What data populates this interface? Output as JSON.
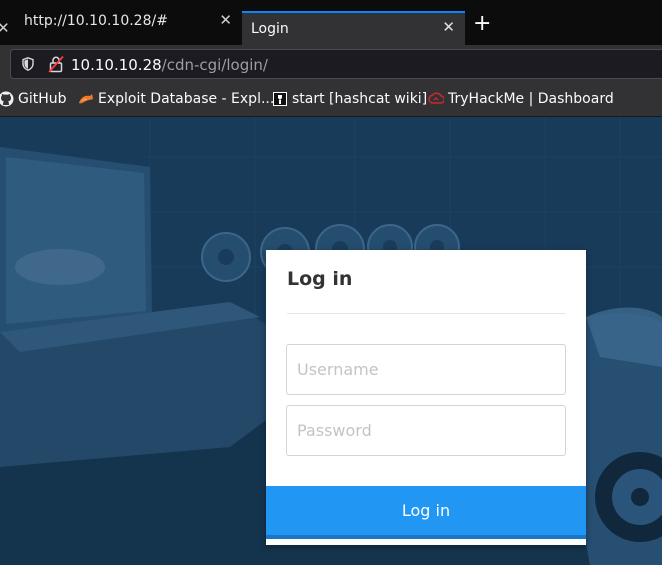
{
  "tabs": [
    {
      "title": "http://10.10.10.28/#",
      "active": false
    },
    {
      "title": "Login",
      "active": true
    }
  ],
  "urlbar": {
    "host": "10.10.10.28",
    "path": "/cdn-cgi/login/"
  },
  "bookmarks": [
    {
      "label": "GitHub",
      "icon": "github-icon"
    },
    {
      "label": "Exploit Database - Expl...",
      "icon": "exploit-db-icon"
    },
    {
      "label": "start [hashcat wiki]",
      "icon": "hashcat-icon"
    },
    {
      "label": "TryHackMe | Dashboard",
      "icon": "tryhackme-icon"
    }
  ],
  "login": {
    "title": "Log in",
    "username_placeholder": "Username",
    "password_placeholder": "Password",
    "button_label": "Log in"
  },
  "colors": {
    "accent": "#0a84ff",
    "button": "#2196f3",
    "page_bg": "#1d4263"
  }
}
